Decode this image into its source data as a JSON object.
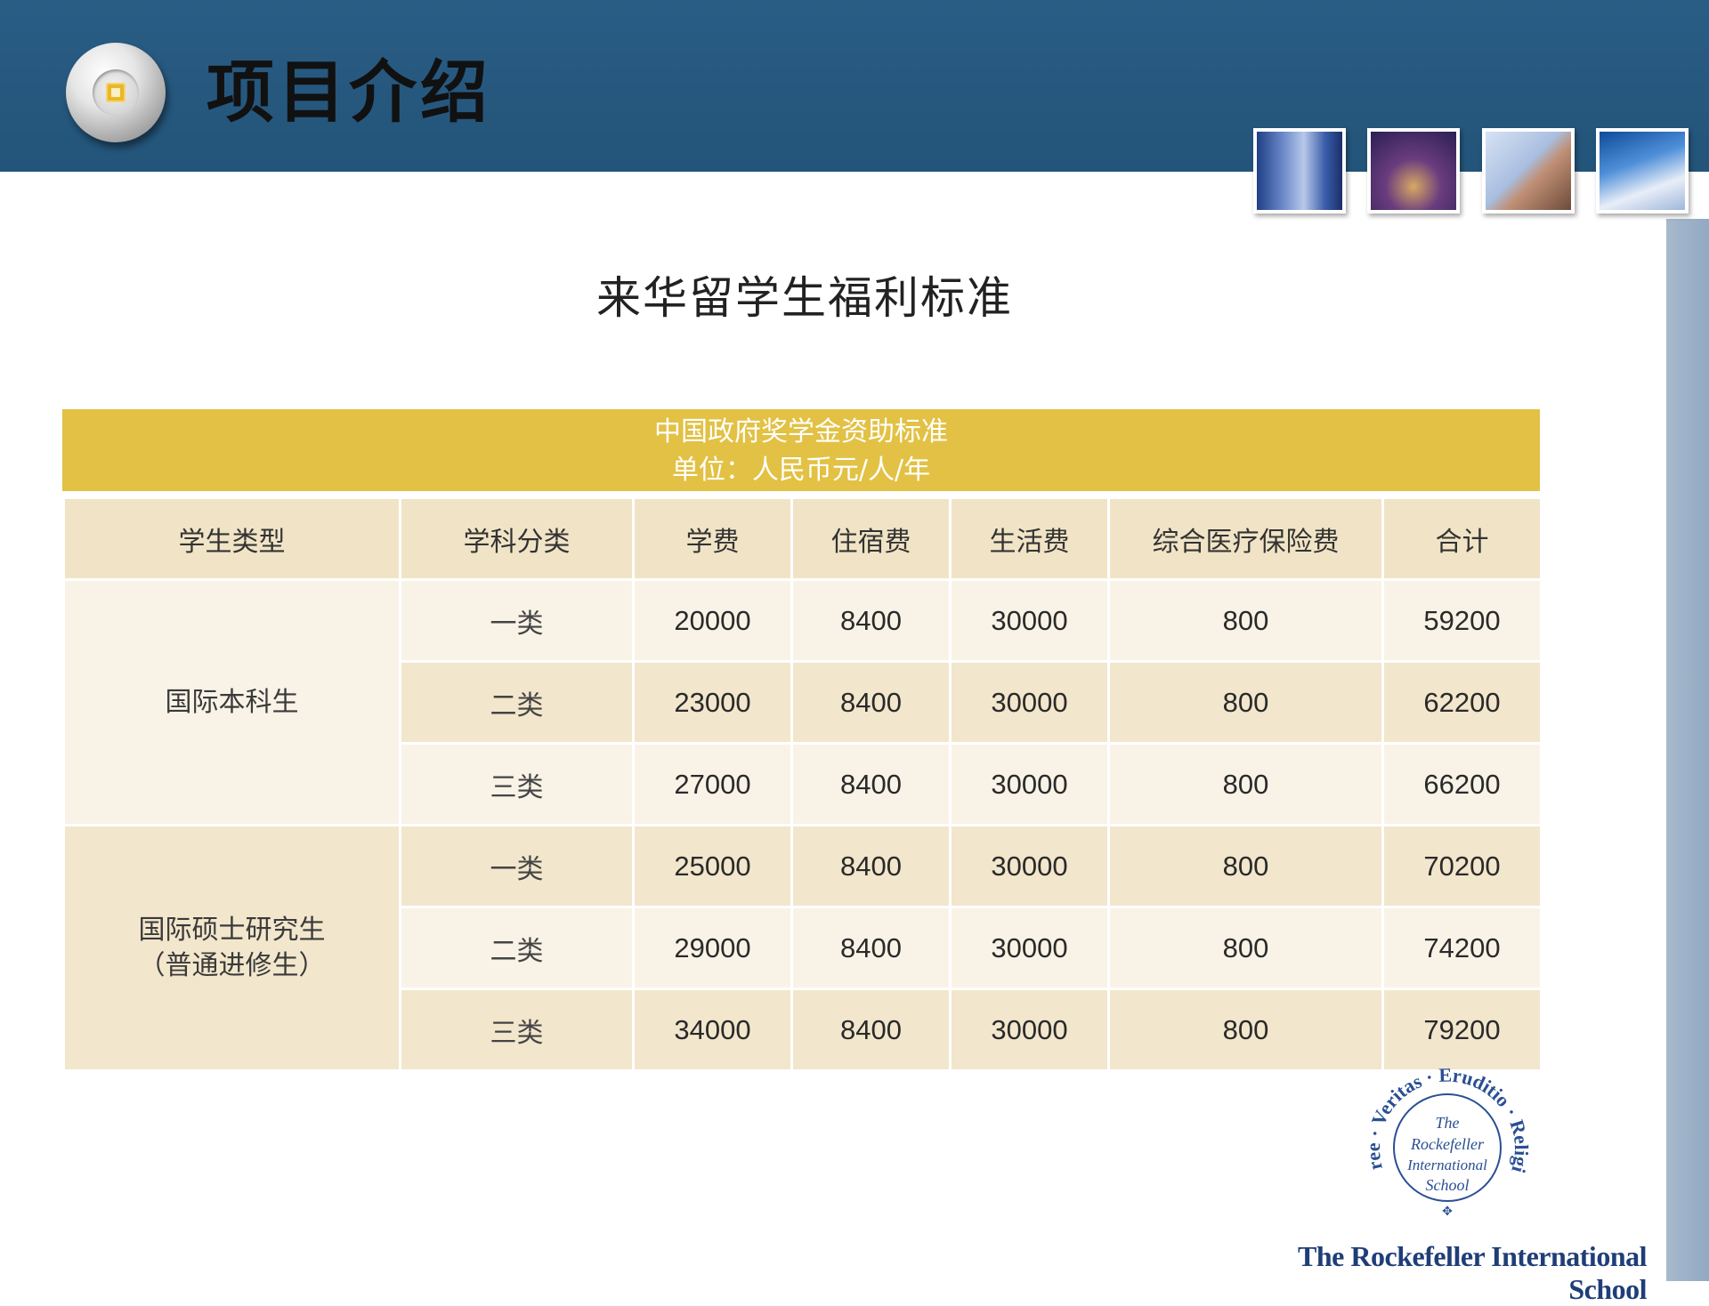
{
  "header": {
    "title": "项目介绍",
    "accent_color": "#2a5d85",
    "photos": [
      "city-tower-photo",
      "city-night-photo",
      "phone-call-photo",
      "skyscraper-photo"
    ]
  },
  "subtitle": "来华留学生福利标准",
  "table": {
    "caption_line1": "中国政府奖学金资助标准",
    "caption_line2": "单位：人民币元/人/年",
    "columns": [
      "学生类型",
      "学科分类",
      "学费",
      "住宿费",
      "生活费",
      "综合医疗保险费",
      "合计"
    ],
    "groups": [
      {
        "type_line1": "国际本科生",
        "type_line2": "",
        "rows": [
          {
            "category": "一类",
            "tuition": "20000",
            "lodging": "8400",
            "living": "30000",
            "insurance": "800",
            "total": "59200"
          },
          {
            "category": "二类",
            "tuition": "23000",
            "lodging": "8400",
            "living": "30000",
            "insurance": "800",
            "total": "62200"
          },
          {
            "category": "三类",
            "tuition": "27000",
            "lodging": "8400",
            "living": "30000",
            "insurance": "800",
            "total": "66200"
          }
        ]
      },
      {
        "type_line1": "国际硕士研究生",
        "type_line2": "（普通进修生）",
        "rows": [
          {
            "category": "一类",
            "tuition": "25000",
            "lodging": "8400",
            "living": "30000",
            "insurance": "800",
            "total": "70200"
          },
          {
            "category": "二类",
            "tuition": "29000",
            "lodging": "8400",
            "living": "30000",
            "insurance": "800",
            "total": "74200"
          },
          {
            "category": "三类",
            "tuition": "34000",
            "lodging": "8400",
            "living": "30000",
            "insurance": "800",
            "total": "79200"
          }
        ]
      }
    ],
    "caption_color": "#e2c144"
  },
  "seal": {
    "ring_text": "Free · Veritas · Eruditio · Religio",
    "center_line1": "The",
    "center_line2": "Rockefeller",
    "center_line3": "International",
    "center_line4": "School"
  },
  "footer": {
    "school_name": "The Rockefeller International School"
  }
}
